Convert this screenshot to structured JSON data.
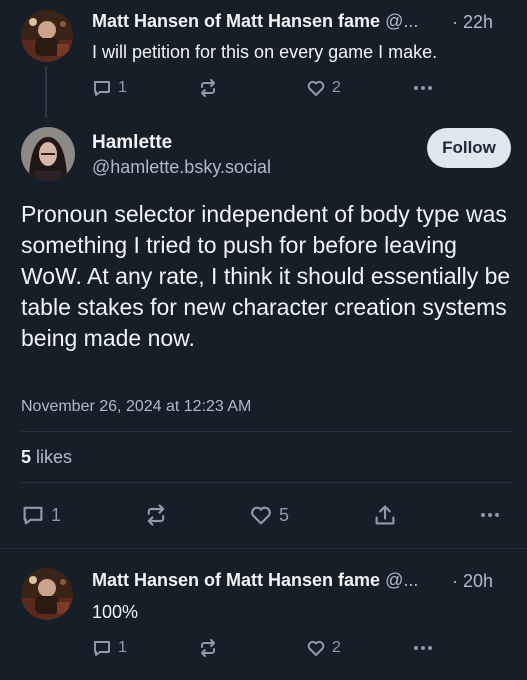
{
  "replies": [
    {
      "author_name": "Matt Hansen of Matt Hansen fame",
      "handle_truncated": "@...",
      "time": "· 22h",
      "text": "I will petition for this on every game I make.",
      "reply_count": "1",
      "repost_count": "",
      "like_count": "2"
    },
    {
      "author_name": "Matt Hansen of Matt Hansen fame",
      "handle_truncated": "@...",
      "time": "· 20h",
      "text": "100%",
      "reply_count": "1",
      "repost_count": "",
      "like_count": "2"
    }
  ],
  "main_post": {
    "author_name": "Hamlette",
    "handle": "@hamlette.bsky.social",
    "follow_label": "Follow",
    "text": "Pronoun selector independent of body type was something I tried to push for before leaving WoW. At any rate, I think it should essentially be table stakes for new character creation systems being made now.",
    "date": "November 26, 2024 at 12:23 AM",
    "likes_count": "5",
    "likes_label": "likes",
    "reply_count": "1",
    "like_count": "5"
  },
  "icons": {
    "reply": "speech-bubble-icon",
    "repost": "repost-arrows-icon",
    "like": "heart-icon",
    "share": "share-icon",
    "more": "more-dots-icon"
  },
  "colors": {
    "background": "#161e27",
    "text_primary": "#f1f3f5",
    "text_secondary": "#aebbc9",
    "icon": "#8c9bab",
    "follow_button_bg": "#dfe6ee",
    "divider": "#26323e"
  }
}
